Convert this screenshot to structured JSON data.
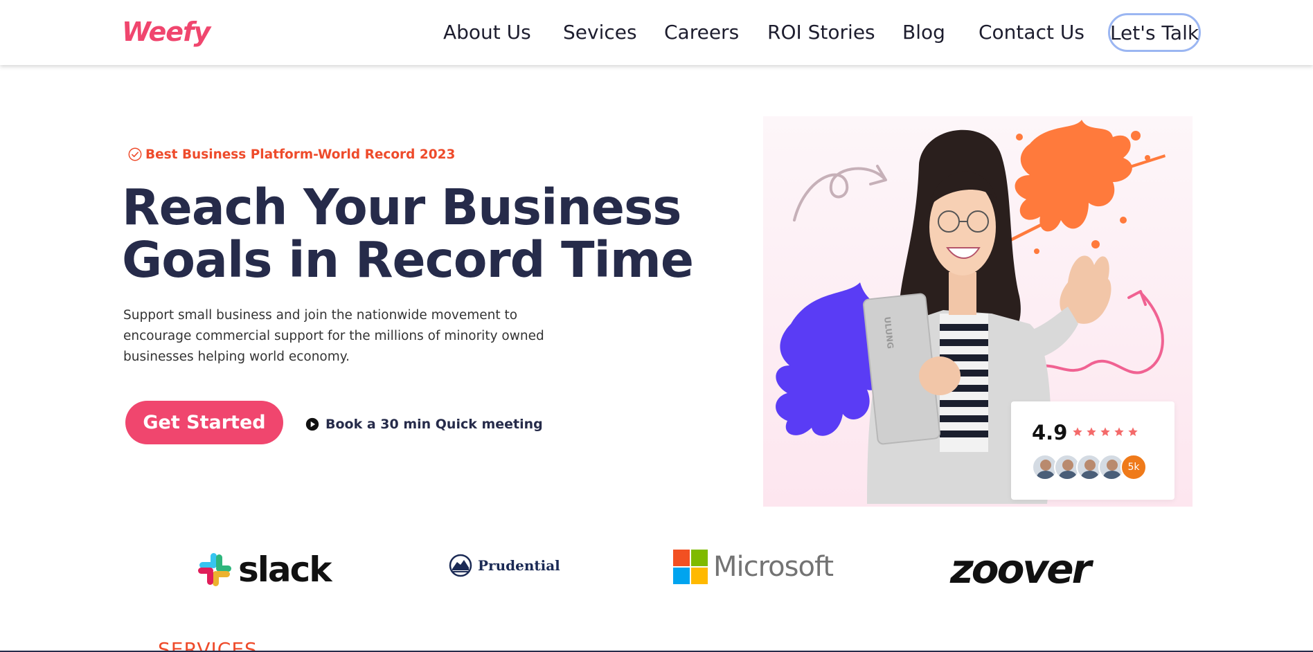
{
  "header": {
    "logo": "Weefy",
    "nav": [
      {
        "label": "About Us"
      },
      {
        "label": "Sevices"
      },
      {
        "label": "Careers"
      },
      {
        "label": "ROI Stories"
      },
      {
        "label": "Blog"
      },
      {
        "label": "Contact Us"
      }
    ],
    "cta_label": "Let's Talk"
  },
  "hero": {
    "badge": "Best Business Platform-World Record 2023",
    "badge_icon": "check-circle-icon",
    "headline_line1": "Reach Your Business",
    "headline_line2": "Goals in Record Time",
    "subtext_line1": "Support small business and join the nationwide movement to",
    "subtext_line2": "encourage commercial support for the millions of minority owned",
    "subtext_line3": "businesses helping world economy.",
    "primary_button": "Get Started",
    "meeting_link": "Book a 30 min Quick meeting",
    "meeting_icon": "play-circle-icon"
  },
  "rating_card": {
    "score": "4.9",
    "stars": 5,
    "count_badge": "5k",
    "laptop_text": "ULUNG"
  },
  "partners": [
    {
      "name": "slack"
    },
    {
      "name": "Prudential"
    },
    {
      "name": "Microsoft"
    },
    {
      "name": "zoover"
    }
  ],
  "next_section_label": "SERVICES",
  "colors": {
    "brand_pink": "#f0466e",
    "accent_orange": "#ee4b2b",
    "headline_navy": "#262b4a",
    "splash_purple": "#5a3cf5",
    "splash_orange": "#ff7a3c"
  }
}
